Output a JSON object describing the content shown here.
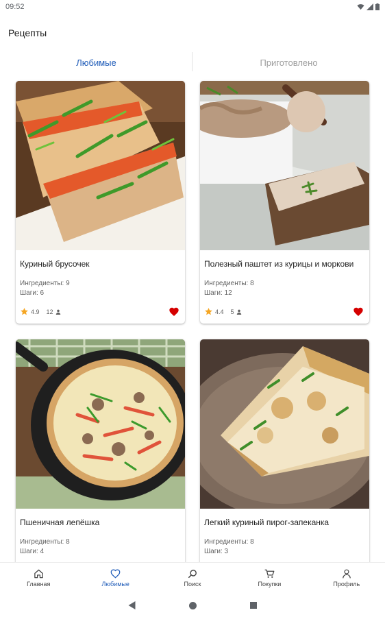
{
  "status_bar": {
    "time": "09:52"
  },
  "appbar": {
    "title": "Рецепты"
  },
  "tabs": [
    {
      "label": "Любимые",
      "active": true
    },
    {
      "label": "Приготовлено",
      "active": false
    }
  ],
  "recipes": [
    {
      "title": "Куриный брусочек",
      "ingredients": "Ингредиенты: 9",
      "steps": "Шаги: 6",
      "rating": "4.9",
      "reviews": "12",
      "favorite": true
    },
    {
      "title": "Полезный паштет из курицы и моркови",
      "ingredients": "Ингредиенты: 8",
      "steps": "Шаги: 12",
      "rating": "4.4",
      "reviews": "5",
      "favorite": true
    },
    {
      "title": "Пшеничная лепёшка",
      "ingredients": "Ингредиенты: 8",
      "steps": "Шаги: 4"
    },
    {
      "title": "Легкий куриный пирог-запеканка",
      "ingredients": "Ингредиенты: 8",
      "steps": "Шаги: 3"
    }
  ],
  "bottom_nav": [
    {
      "label": "Главная",
      "icon": "home-icon",
      "active": false
    },
    {
      "label": "Любимые",
      "icon": "heart-outline-icon",
      "active": true
    },
    {
      "label": "Поиск",
      "icon": "search-icon",
      "active": false
    },
    {
      "label": "Покупки",
      "icon": "cart-icon",
      "active": false
    },
    {
      "label": "Профиль",
      "icon": "person-icon",
      "active": false
    }
  ],
  "colors": {
    "accent": "#1e5bb8",
    "heart": "#d50000",
    "star": "#f5a623"
  }
}
